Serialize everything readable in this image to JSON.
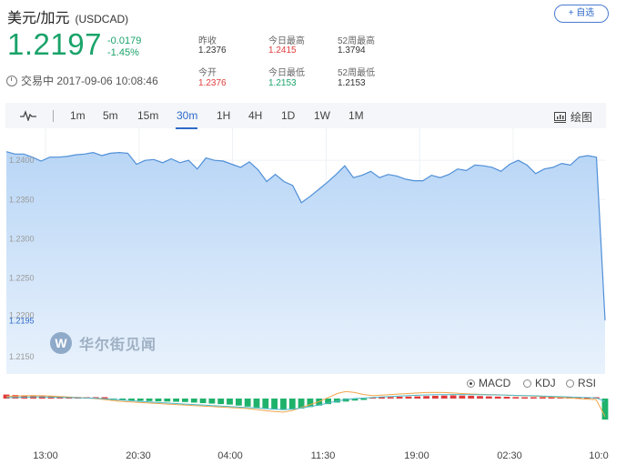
{
  "header": {
    "title": "美元/加元",
    "code": "(USDCAD)",
    "watch_button": "+ 自选",
    "price": "1.2197",
    "change": "-0.0179",
    "change_pct": "-1.45%",
    "status": "交易中 2017-09-06 10:08:46"
  },
  "stats": [
    {
      "label": "昨收",
      "value": "1.2376",
      "color": "#333333"
    },
    {
      "label": "今日最高",
      "value": "1.2415",
      "color": "#e23b3b"
    },
    {
      "label": "52周最高",
      "value": "1.3794",
      "color": "#333333"
    },
    {
      "label": "今开",
      "value": "1.2376",
      "color": "#e23b3b"
    },
    {
      "label": "今日最低",
      "value": "1.2153",
      "color": "#1aa36a"
    },
    {
      "label": "52周最低",
      "value": "1.2153",
      "color": "#333333"
    }
  ],
  "toolbar": {
    "periods": [
      "1m",
      "5m",
      "15m",
      "30m",
      "1H",
      "4H",
      "1D",
      "1W",
      "1M"
    ],
    "active": "30m",
    "draw_label": "绘图"
  },
  "watermark": "华尔街见闻",
  "indicators": {
    "options": [
      "MACD",
      "KDJ",
      "RSI"
    ],
    "selected": "MACD"
  },
  "chart_data": {
    "type": "area",
    "ylim": [
      1.213,
      1.2435
    ],
    "y_ticks": [
      "1.2400",
      "1.2350",
      "1.2300",
      "1.2250",
      "1.2200",
      "1.2195",
      "1.2150"
    ],
    "x_ticks": [
      "13:00",
      "20:30",
      "04:00",
      "11:30",
      "19:00",
      "02:30",
      "10:0"
    ],
    "values": [
      1.2411,
      1.2408,
      1.2408,
      1.2404,
      1.2399,
      1.2404,
      1.2404,
      1.2405,
      1.2407,
      1.2408,
      1.241,
      1.2406,
      1.2409,
      1.241,
      1.2409,
      1.2395,
      1.24,
      1.2401,
      1.2397,
      1.2402,
      1.2397,
      1.24,
      1.2389,
      1.2403,
      1.24,
      1.2399,
      1.2395,
      1.2391,
      1.2398,
      1.2388,
      1.2373,
      1.2382,
      1.2373,
      1.2368,
      1.2346,
      1.2354,
      1.2363,
      1.2372,
      1.2382,
      1.2393,
      1.2378,
      1.2381,
      1.2386,
      1.2378,
      1.2382,
      1.238,
      1.2376,
      1.2374,
      1.2374,
      1.2381,
      1.2378,
      1.2382,
      1.2389,
      1.2387,
      1.2394,
      1.2393,
      1.2391,
      1.2386,
      1.2395,
      1.24,
      1.2394,
      1.2383,
      1.2389,
      1.2391,
      1.2396,
      1.2394,
      1.2404,
      1.2406,
      1.2404,
      1.2196
    ],
    "macd_hist": [
      0.4,
      0.35,
      0.3,
      0.28,
      0.25,
      0.22,
      0.2,
      0.18,
      0.15,
      0.12,
      0.1,
      0.05,
      -0.05,
      -0.12,
      -0.18,
      -0.22,
      -0.25,
      -0.28,
      -0.3,
      -0.32,
      -0.35,
      -0.4,
      -0.45,
      -0.5,
      -0.55,
      -0.6,
      -0.7,
      -0.8,
      -0.9,
      -1.0,
      -1.1,
      -1.15,
      -1.1,
      -1.0,
      -0.85,
      -0.7,
      -0.55,
      -0.4,
      -0.3,
      -0.2,
      -0.1,
      0.05,
      0.1,
      0.15,
      0.18,
      0.2,
      0.22,
      0.25,
      0.28,
      0.3,
      0.32,
      0.3,
      0.28,
      0.25,
      0.22,
      0.2,
      0.18,
      0.15,
      0.12,
      0.1,
      0.08,
      0.05,
      0.05,
      0.1,
      0.12,
      0.1,
      0.08,
      -2.1
    ],
    "dif": [
      0.2,
      0.25,
      0.28,
      0.3,
      0.28,
      0.25,
      0.2,
      0.15,
      0.1,
      0.05,
      0.0,
      -0.1,
      -0.2,
      -0.3,
      -0.35,
      -0.4,
      -0.45,
      -0.5,
      -0.55,
      -0.6,
      -0.65,
      -0.7,
      -0.75,
      -0.8,
      -0.85,
      -0.9,
      -0.95,
      -1.0,
      -1.1,
      -1.2,
      -1.3,
      -1.35,
      -1.2,
      -0.9,
      -0.6,
      -0.3,
      0.1,
      0.5,
      0.7,
      0.6,
      0.4,
      0.3,
      0.35,
      0.4,
      0.45,
      0.5,
      0.55,
      0.6,
      0.62,
      0.6,
      0.55,
      0.5,
      0.45,
      0.42,
      0.4,
      0.38,
      0.35,
      0.3,
      0.28,
      0.25,
      0.2,
      0.15,
      0.1,
      0.05,
      0.0,
      -0.05,
      -0.1,
      -1.8
    ],
    "dea": [
      0.1,
      0.12,
      0.14,
      0.15,
      0.15,
      0.14,
      0.12,
      0.1,
      0.08,
      0.05,
      0.02,
      -0.02,
      -0.08,
      -0.15,
      -0.22,
      -0.28,
      -0.35,
      -0.4,
      -0.45,
      -0.5,
      -0.55,
      -0.6,
      -0.65,
      -0.7,
      -0.75,
      -0.8,
      -0.85,
      -0.9,
      -0.95,
      -1.0,
      -1.05,
      -1.1,
      -1.05,
      -0.95,
      -0.8,
      -0.65,
      -0.45,
      -0.25,
      -0.1,
      0.0,
      0.05,
      0.1,
      0.15,
      0.2,
      0.25,
      0.3,
      0.33,
      0.36,
      0.38,
      0.39,
      0.4,
      0.4,
      0.39,
      0.38,
      0.37,
      0.36,
      0.34,
      0.32,
      0.3,
      0.28,
      0.25,
      0.22,
      0.19,
      0.16,
      0.13,
      0.1,
      0.07,
      -0.3
    ]
  }
}
